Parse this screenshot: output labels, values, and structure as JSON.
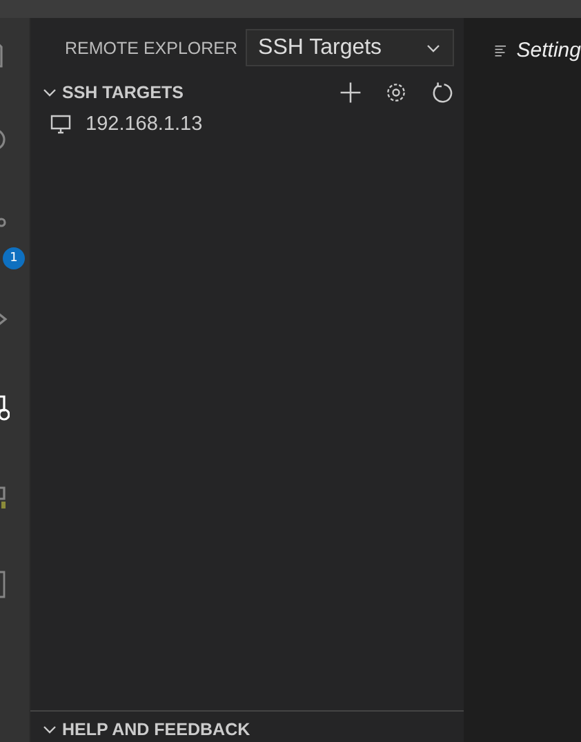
{
  "activity_bar": {
    "items": [
      {
        "kind": "files",
        "selected": false
      },
      {
        "kind": "search",
        "selected": false
      },
      {
        "kind": "source-control",
        "selected": false,
        "badge": "1"
      },
      {
        "kind": "run",
        "selected": false
      },
      {
        "kind": "remote",
        "selected": true
      },
      {
        "kind": "extensions",
        "selected": false
      },
      {
        "kind": "document",
        "selected": false
      }
    ]
  },
  "sidebar": {
    "title": "REMOTE EXPLORER",
    "dropdown": {
      "value": "SSH Targets"
    },
    "sections": [
      {
        "title": "SSH TARGETS",
        "expanded": true,
        "actions": [
          {
            "kind": "add"
          },
          {
            "kind": "settings"
          },
          {
            "kind": "refresh"
          }
        ],
        "items": [
          {
            "label": "192.168.1.13"
          }
        ]
      }
    ],
    "footer_section": {
      "title": "HELP AND FEEDBACK",
      "expanded": true
    }
  },
  "editor": {
    "tab": {
      "label": "Setting"
    }
  }
}
